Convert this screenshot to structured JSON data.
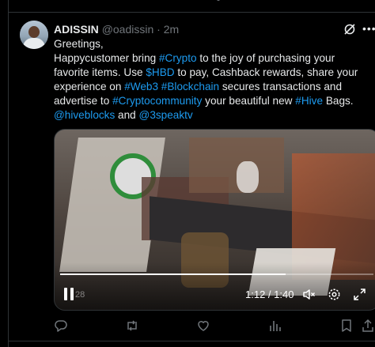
{
  "tweet": {
    "author_name": "ADISSIN",
    "handle": "@oadissin",
    "separator": "·",
    "time": "2m",
    "lines": [
      [
        {
          "t": "Greetings,",
          "link": false
        }
      ],
      [
        {
          "t": "Happycustomer bring ",
          "link": false
        },
        {
          "t": "#Crypto",
          "link": true
        },
        {
          "t": " to the joy of purchasing your",
          "link": false
        }
      ],
      [
        {
          "t": "favorite items. Use ",
          "link": false
        },
        {
          "t": "$HBD",
          "link": true
        },
        {
          "t": " to pay, Cashback rewards, share your",
          "link": false
        }
      ],
      [
        {
          "t": "experience on ",
          "link": false
        },
        {
          "t": "#Web3",
          "link": true
        },
        {
          "t": " ",
          "link": false
        },
        {
          "t": "#Blockchain",
          "link": true
        },
        {
          "t": " secures transactions and",
          "link": false
        }
      ],
      [
        {
          "t": "advertise to ",
          "link": false
        },
        {
          "t": "#Cryptocommunity",
          "link": true
        },
        {
          "t": " your beautiful new ",
          "link": false
        },
        {
          "t": "#Hive",
          "link": true
        },
        {
          "t": " Bags.",
          "link": false
        }
      ],
      [
        {
          "t": "@hiveblocks",
          "link": true
        },
        {
          "t": " and ",
          "link": false
        },
        {
          "t": "@3speaktv",
          "link": true
        }
      ]
    ]
  },
  "video": {
    "time_display": "1:12 / 1:40",
    "progress_fraction": 0.72,
    "preview_label": "28"
  },
  "icons": {
    "grok": "grok-icon",
    "more": "more-icon",
    "reply": "reply-icon",
    "retweet": "retweet-icon",
    "like": "like-icon",
    "views": "views-icon",
    "bookmark": "bookmark-icon",
    "share": "share-icon",
    "pause": "pause-icon",
    "mute": "mute-icon",
    "settings": "settings-icon",
    "fullscreen": "fullscreen-icon"
  },
  "colors": {
    "background": "#000000",
    "text": "#e7e9ea",
    "muted": "#71767b",
    "link": "#1d9bf0",
    "border": "#2f3336"
  }
}
